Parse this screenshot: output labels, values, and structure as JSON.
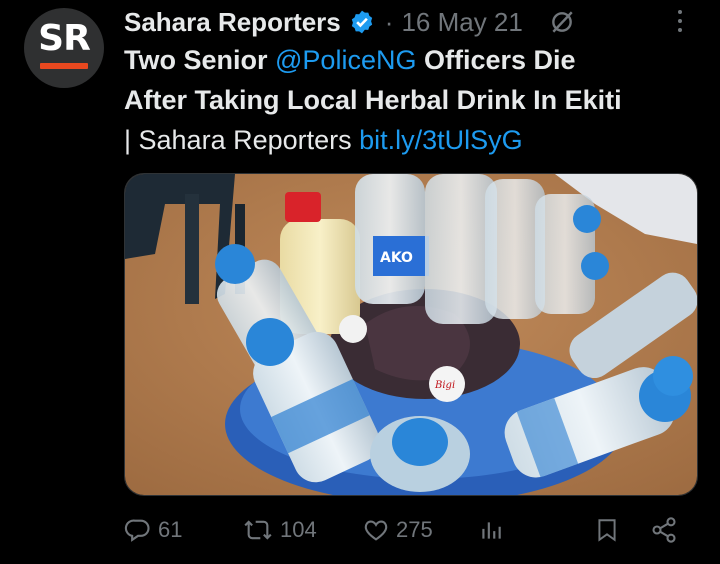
{
  "account": {
    "avatar_letters": "SR",
    "name": "Sahara Reporters",
    "separator": "·",
    "date": "16 May 21"
  },
  "tweet": {
    "line1_a": "Two Senior ",
    "mention": "@PoliceNG",
    "line1_b": " Officers Die",
    "line2": "After Taking Local Herbal Drink In Ekiti",
    "line3": "| Sahara Reporters ",
    "link": "bit.ly/3tUlSyG"
  },
  "media": {
    "bottle_label_text": "AKO",
    "cap_label_text": "Bigi"
  },
  "actions": {
    "replies": "61",
    "retweets": "104",
    "likes": "275"
  },
  "icons": {
    "verified": "verified-badge-icon",
    "grok": "grok-icon",
    "more": "more-options-icon",
    "reply": "reply-icon",
    "retweet": "retweet-icon",
    "like": "heart-icon",
    "views": "analytics-icon",
    "bookmark": "bookmark-icon",
    "share": "share-icon"
  },
  "colors": {
    "accent": "#1d9bf0",
    "muted": "#71767b",
    "brand_bar": "#e8481f"
  }
}
